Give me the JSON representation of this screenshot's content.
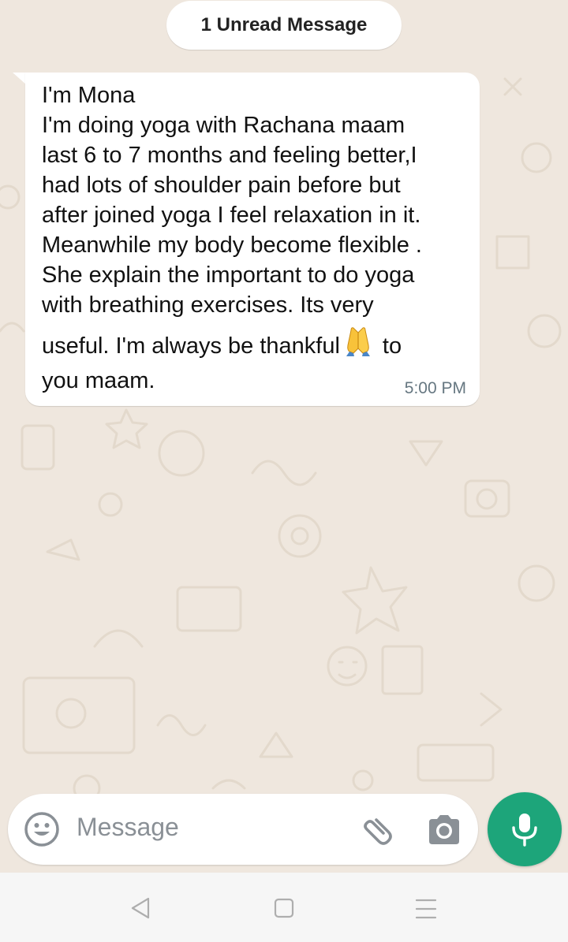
{
  "banner": {
    "unread_label": "1 Unread Message"
  },
  "message": {
    "lines": [
      "I'm Mona",
      "I'm doing yoga with Rachana maam",
      "last 6 to 7 months and feeling better,I",
      "had lots of shoulder pain before but",
      "after joined yoga I feel relaxation in it.",
      "Meanwhile my body become flexible .",
      "She explain the important to do yoga",
      "with breathing exercises. Its very"
    ],
    "line_before_emoji": "useful. I'm always be thankful",
    "emoji": "folded-hands-emoji",
    "line_after_emoji": "to",
    "last_line": "you maam.",
    "time": "5:00 PM"
  },
  "composer": {
    "placeholder": "Message",
    "emoji_icon": "smiley-icon",
    "attach_icon": "paperclip-icon",
    "camera_icon": "camera-icon",
    "mic_icon": "microphone-icon"
  },
  "navbar": {
    "back_icon": "back-triangle-icon",
    "home_icon": "home-square-icon",
    "menu_icon": "menu-lines-icon"
  },
  "colors": {
    "wallpaper": "#EFE7DE",
    "bubble": "#FFFFFF",
    "accent_green": "#1DA57A",
    "timestamp": "#667781"
  }
}
